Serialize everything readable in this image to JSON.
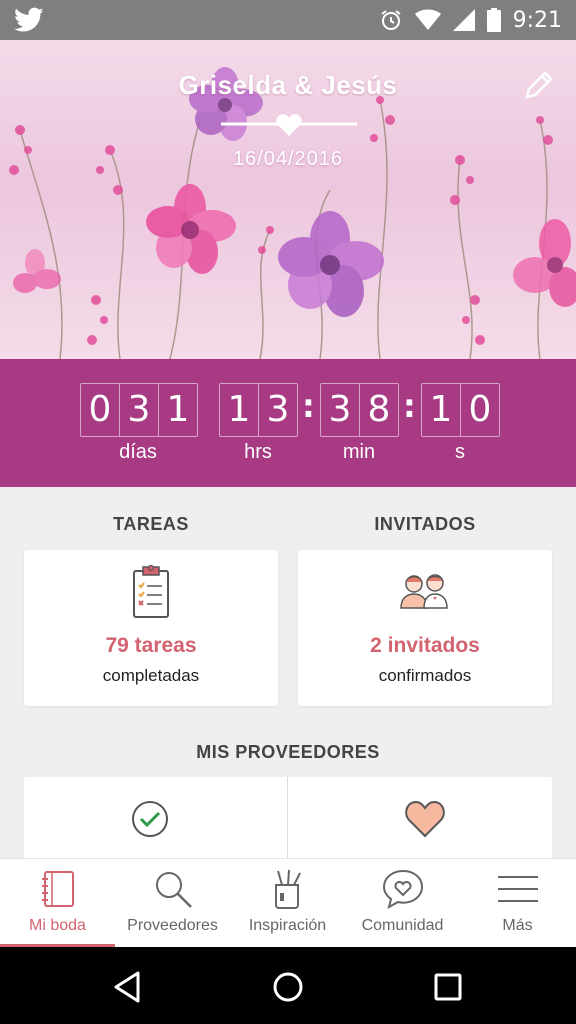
{
  "status_bar": {
    "time": "9:21"
  },
  "header": {
    "couple_names": "Griselda & Jesús",
    "wedding_date": "16/04/2016"
  },
  "countdown": {
    "days_digits": [
      "0",
      "3",
      "1"
    ],
    "hours_digits": [
      "1",
      "3"
    ],
    "minutes_digits": [
      "3",
      "8"
    ],
    "seconds_digits": [
      "1",
      "0"
    ],
    "days_label": "días",
    "hours_label": "hrs",
    "minutes_label": "min",
    "seconds_label": "s",
    "separator": ":"
  },
  "tasks": {
    "title": "TAREAS",
    "count_text": "79 tareas",
    "sub_text": "completadas"
  },
  "guests": {
    "title": "INVITADOS",
    "count_text": "2 invitados",
    "sub_text": "confirmados"
  },
  "providers": {
    "title": "MIS PROVEEDORES"
  },
  "tabs": [
    {
      "label": "Mi boda",
      "icon": "notebook-icon",
      "active": true
    },
    {
      "label": "Proveedores",
      "icon": "search-icon",
      "active": false
    },
    {
      "label": "Inspiración",
      "icon": "pencil-cup-icon",
      "active": false
    },
    {
      "label": "Comunidad",
      "icon": "chat-heart-icon",
      "active": false
    },
    {
      "label": "Más",
      "icon": "menu-icon",
      "active": false
    }
  ],
  "colors": {
    "accent": "#d2636f",
    "countdown_bg": "#a73a82",
    "statusbar_bg": "#7f7f7f",
    "check_green": "#2e9a4a",
    "heart_peach": "#f6b9a0"
  }
}
